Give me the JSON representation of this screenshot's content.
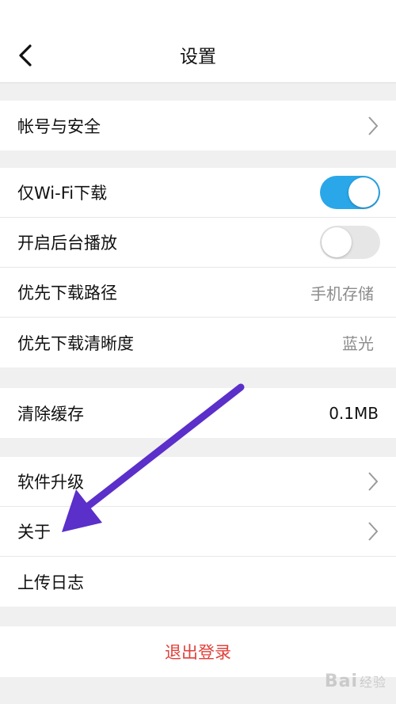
{
  "header": {
    "title": "设置",
    "back_icon": "chevron-left-icon"
  },
  "sections": {
    "account": {
      "items": [
        {
          "label": "帐号与安全",
          "icon": "chevron-right-icon"
        }
      ]
    },
    "download": {
      "items": [
        {
          "label": "仅Wi-Fi下载",
          "toggle": "on"
        },
        {
          "label": "开启后台播放",
          "toggle": "off"
        },
        {
          "label": "优先下载路径",
          "value": "手机存储"
        },
        {
          "label": "优先下载清晰度",
          "value": "蓝光"
        }
      ]
    },
    "cache": {
      "items": [
        {
          "label": "清除缓存",
          "value": "0.1MB"
        }
      ]
    },
    "about": {
      "items": [
        {
          "label": "软件升级",
          "icon": "chevron-right-icon"
        },
        {
          "label": "关于",
          "icon": "chevron-right-icon"
        },
        {
          "label": "上传日志"
        }
      ]
    }
  },
  "logout": {
    "label": "退出登录",
    "color": "#e0413b"
  },
  "watermark": {
    "text": "Bai",
    "sub": "经验"
  },
  "colors": {
    "toggle_on": "#2aa7e8",
    "toggle_off": "#e6e6e6",
    "annotation_arrow": "#5b2fc9",
    "logout_text": "#e0413b"
  }
}
